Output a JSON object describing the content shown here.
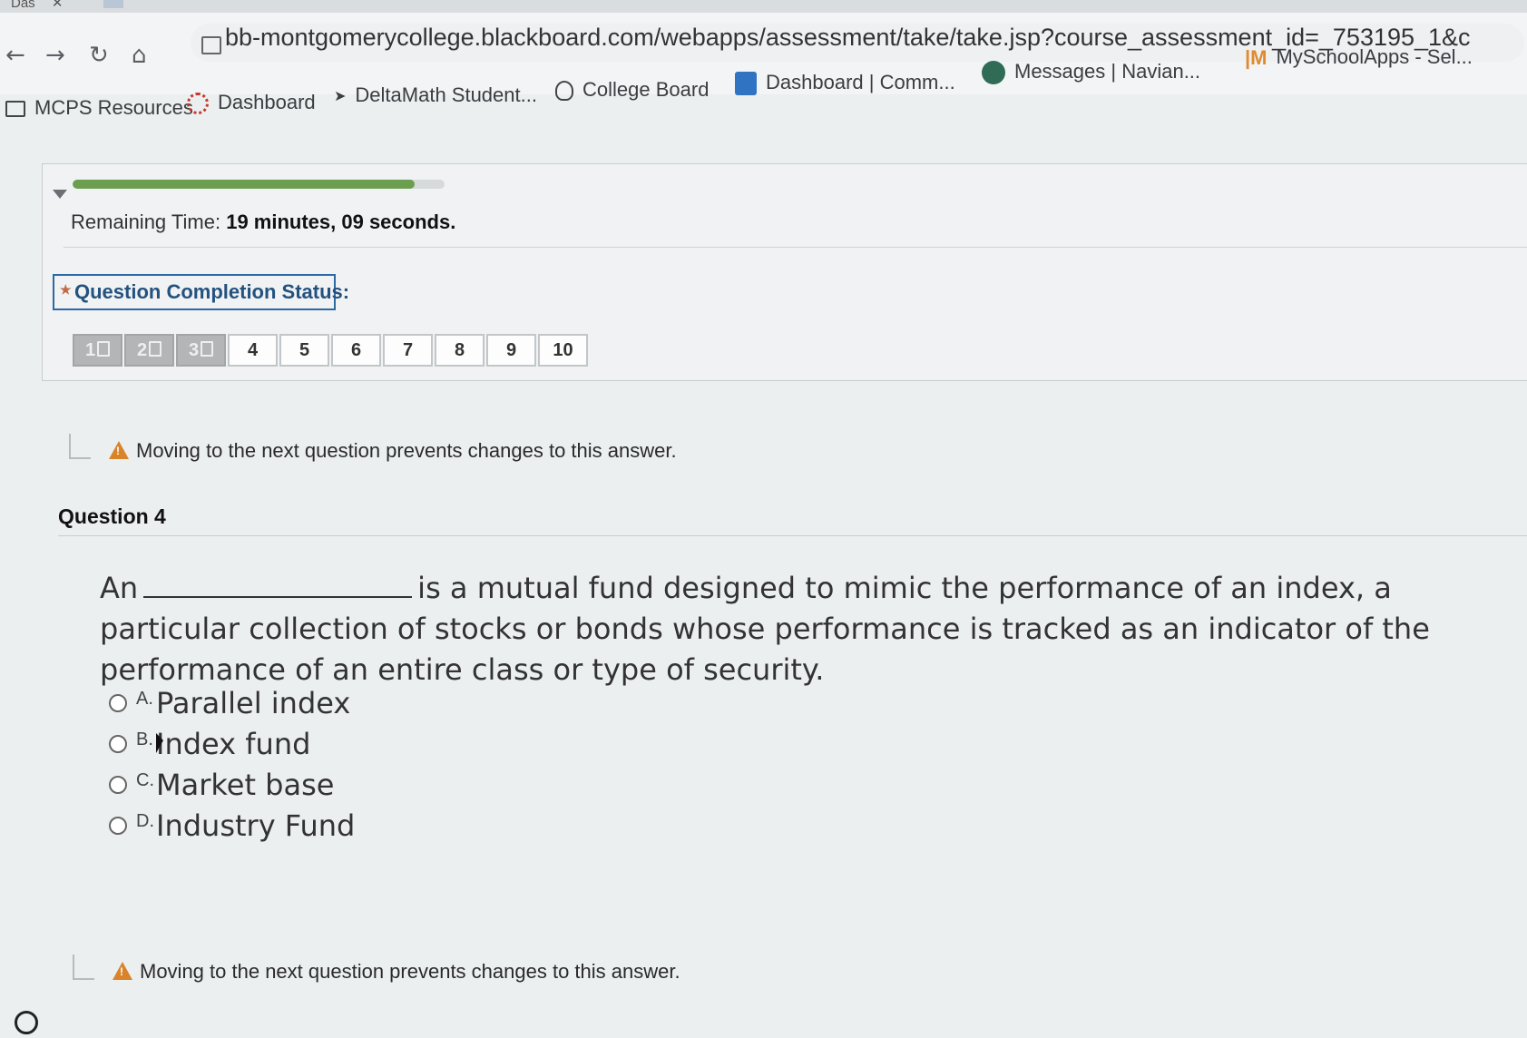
{
  "browser": {
    "tab_title_fragment": "Das",
    "url": "bb-montgomerycollege.blackboard.com/webapps/assessment/take/take.jsp?course_assessment_id=_753195_1&c",
    "bookmarks": [
      {
        "label": "MCPS Resources",
        "icon": "folder-icon"
      },
      {
        "label": "Dashboard",
        "icon": "canvas-icon"
      },
      {
        "label": "DeltaMath Student...",
        "icon": "deltamath-icon"
      },
      {
        "label": "College Board",
        "icon": "acorn-icon"
      },
      {
        "label": "Dashboard | Comm...",
        "icon": "commonlit-icon"
      },
      {
        "label": "Messages | Navian...",
        "icon": "naviance-icon"
      },
      {
        "label": "MySchoolApps - Sel...",
        "icon": "myschoolapps-icon"
      }
    ]
  },
  "assessment": {
    "progress_fraction": 0.92,
    "timer_label": "Remaining Time:",
    "timer_value": "19 minutes, 09 seconds.",
    "completion_status_label": "Question Completion Status:",
    "question_buttons": [
      {
        "label": "1",
        "answered": true
      },
      {
        "label": "2",
        "answered": true
      },
      {
        "label": "3",
        "answered": true
      },
      {
        "label": "4",
        "answered": false
      },
      {
        "label": "5",
        "answered": false
      },
      {
        "label": "6",
        "answered": false
      },
      {
        "label": "7",
        "answered": false
      },
      {
        "label": "8",
        "answered": false
      },
      {
        "label": "9",
        "answered": false
      },
      {
        "label": "10",
        "answered": false
      }
    ],
    "warning_text": "Moving to the next question prevents changes to this answer.",
    "question_title": "Question 4",
    "question_prefix": "An",
    "question_body": "is a mutual fund designed to mimic the performance of an index, a particular collection of stocks or bonds whose performance is tracked as an indicator of the performance of an entire class or type of security.",
    "options": [
      {
        "letter": "A.",
        "text": "Parallel index"
      },
      {
        "letter": "B.",
        "text": "Index fund"
      },
      {
        "letter": "C.",
        "text": "Market base"
      },
      {
        "letter": "D.",
        "text": "Industry Fund"
      }
    ]
  },
  "colors": {
    "accent_blue": "#2d6aa3",
    "progress_green": "#6b9f4f",
    "warning_orange": "#d9832b"
  }
}
